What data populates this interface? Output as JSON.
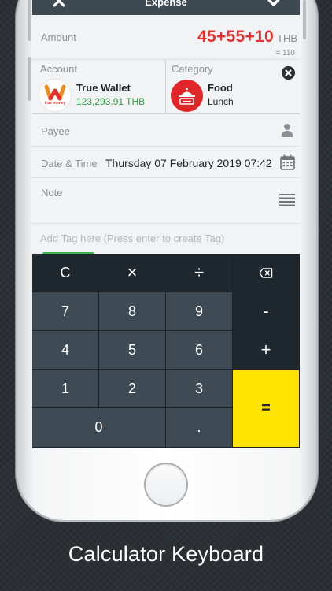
{
  "header": {
    "title": "Expense",
    "close_icon": "close-icon",
    "confirm_icon": "check-icon"
  },
  "amount": {
    "label": "Amount",
    "expression": "45+55+10",
    "currency": "THB",
    "result": "= 110"
  },
  "account": {
    "label": "Account",
    "name": "True Wallet",
    "balance": "123,293.91 THB",
    "logo_text": "true money",
    "icon": "truemoney-logo"
  },
  "category": {
    "label": "Category",
    "name": "Food",
    "sub": "Lunch",
    "icon": "food-tray-icon",
    "clear_icon": "close-circle-icon"
  },
  "payee": {
    "label": "Payee",
    "icon": "person-icon"
  },
  "date": {
    "label": "Date & Time",
    "value": "Thursday 07 February 2019 07:42",
    "icon": "calendar-icon"
  },
  "note": {
    "label": "Note",
    "icon": "lines-icon"
  },
  "tag": {
    "placeholder": "Add Tag here (Press enter to create Tag)"
  },
  "keypad": {
    "clear": "C",
    "multiply": "×",
    "divide": "÷",
    "backspace_icon": "backspace-icon",
    "k7": "7",
    "k8": "8",
    "k9": "9",
    "minus": "-",
    "k4": "4",
    "k5": "5",
    "k6": "6",
    "plus": "+",
    "k1": "1",
    "k2": "2",
    "k3": "3",
    "equals": "=",
    "k0": "0",
    "dot": "."
  },
  "caption": "Calculator Keyboard",
  "colors": {
    "accent_red": "#e4312f",
    "balance_green": "#2f9e44",
    "equals_yellow": "#ffe400",
    "header": "#3d4a52",
    "key": "#3e4b54",
    "key_dark": "#1e282e"
  }
}
